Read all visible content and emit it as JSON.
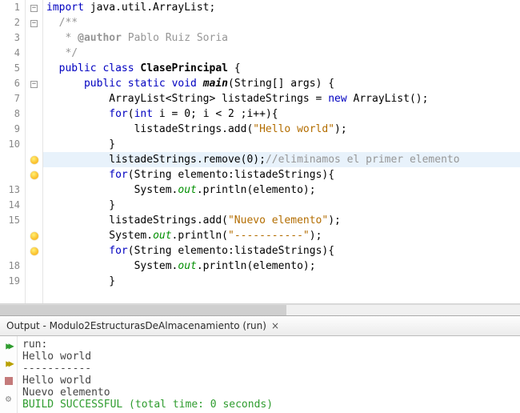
{
  "editor": {
    "line_numbers": [
      "1",
      "2",
      "3",
      "4",
      "5",
      "6",
      "7",
      "8",
      "9",
      "10",
      "",
      "",
      "13",
      "14",
      "15",
      "",
      "",
      "18",
      "19"
    ],
    "glyph_types": [
      "fold",
      "fold",
      "none",
      "none",
      "none",
      "fold",
      "none",
      "none",
      "none",
      "none",
      "bulb",
      "bulb",
      "none",
      "none",
      "none",
      "bulb",
      "bulb",
      "none",
      "none"
    ],
    "highlight_index": 10,
    "tokens": [
      [
        [
          "kw",
          "import"
        ],
        [
          "",
          " java.util.ArrayList;"
        ]
      ],
      [
        [
          "",
          "  "
        ],
        [
          "cmt",
          "/**"
        ]
      ],
      [
        [
          "cmt",
          "   * "
        ],
        [
          "cmt-b",
          "@author"
        ],
        [
          "cmt",
          " Pablo Ruiz Soria"
        ]
      ],
      [
        [
          "cmt",
          "   */"
        ]
      ],
      [
        [
          "",
          "  "
        ],
        [
          "kw",
          "public"
        ],
        [
          "",
          " "
        ],
        [
          "kw",
          "class"
        ],
        [
          "",
          " "
        ],
        [
          "cls",
          "ClasePrincipal"
        ],
        [
          "",
          " {"
        ]
      ],
      [
        [
          "",
          "      "
        ],
        [
          "kw",
          "public"
        ],
        [
          "",
          " "
        ],
        [
          "kw",
          "static"
        ],
        [
          "",
          " "
        ],
        [
          "kw",
          "void"
        ],
        [
          "",
          " "
        ],
        [
          "mth",
          "main"
        ],
        [
          "",
          "(String[] args) {"
        ]
      ],
      [
        [
          "",
          "          ArrayList<String> listadeStrings = "
        ],
        [
          "kw",
          "new"
        ],
        [
          "",
          " ArrayList();"
        ]
      ],
      [
        [
          "",
          "          "
        ],
        [
          "kw",
          "for"
        ],
        [
          "",
          "("
        ],
        [
          "kw",
          "int"
        ],
        [
          "",
          " i = 0; i < 2 ;i++){"
        ]
      ],
      [
        [
          "",
          "              listadeStrings.add("
        ],
        [
          "str",
          "\"Hello world\""
        ],
        [
          "",
          ");"
        ]
      ],
      [
        [
          "",
          "          }"
        ]
      ],
      [
        [
          "",
          "          listadeStrings.remove(0);"
        ],
        [
          "cmt",
          "//eliminamos el primer elemento"
        ]
      ],
      [
        [
          "",
          "          "
        ],
        [
          "kw",
          "for"
        ],
        [
          "",
          "(String elemento:listadeStrings){"
        ]
      ],
      [
        [
          "",
          "              System."
        ],
        [
          "fld",
          "out"
        ],
        [
          "",
          ".println(elemento);"
        ]
      ],
      [
        [
          "",
          "          }"
        ]
      ],
      [
        [
          "",
          "          listadeStrings.add("
        ],
        [
          "str",
          "\"Nuevo elemento\""
        ],
        [
          "",
          ");"
        ]
      ],
      [
        [
          "",
          "          System."
        ],
        [
          "fld",
          "out"
        ],
        [
          "",
          ".println("
        ],
        [
          "str",
          "\"-----------\""
        ],
        [
          "",
          ");"
        ]
      ],
      [
        [
          "",
          "          "
        ],
        [
          "kw",
          "for"
        ],
        [
          "",
          "(String elemento:listadeStrings){"
        ]
      ],
      [
        [
          "",
          "              System."
        ],
        [
          "fld",
          "out"
        ],
        [
          "",
          ".println(elemento);"
        ]
      ],
      [
        [
          "",
          "          }"
        ]
      ]
    ]
  },
  "output": {
    "tab_title": "Output - Modulo2EstructurasDeAlmacenamiento (run)",
    "tab_close": "×",
    "lines": [
      "run:",
      "Hello world",
      "-----------",
      "Hello world",
      "Nuevo elemento"
    ],
    "build_status": "BUILD SUCCESSFUL (total time: 0 seconds)"
  }
}
